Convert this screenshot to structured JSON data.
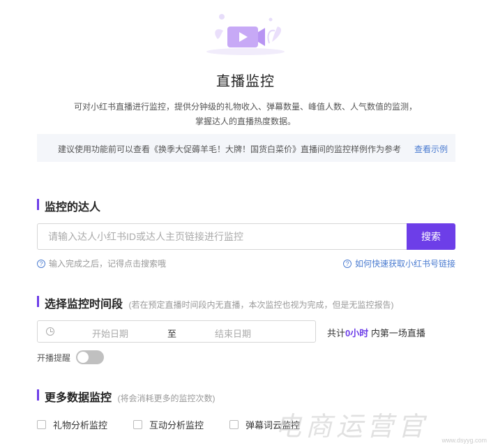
{
  "header": {
    "title": "直播监控",
    "desc_line1": "可对小红书直播进行监控，提供分钟级的礼物收入、弹幕数量、峰值人数、人气数值的监测，",
    "desc_line2": "掌握达人的直播热度数据。"
  },
  "tip": {
    "text": "建议使用功能前可以查看《换季大促薅羊毛！大牌！国货白菜价》直播间的监控样例作为参考",
    "link": "查看示例"
  },
  "monitor_section": {
    "title": "监控的达人",
    "search_placeholder": "请输入达人小红书ID或达人主页链接进行监控",
    "search_button": "搜索",
    "help_left": "输入完成之后，记得点击搜索哦",
    "help_right": "如何快速获取小红书号链接"
  },
  "time_section": {
    "title": "选择监控时间段",
    "note": "(若在预定直播时间段内无直播，本次监控也视为完成，但是无监控报告)",
    "start_placeholder": "开始日期",
    "separator": "至",
    "end_placeholder": "结束日期",
    "total_prefix": "共计",
    "total_value": "0小时",
    "total_suffix": " 内第一场直播",
    "remind_label": "开播提醒"
  },
  "more_section": {
    "title": "更多数据监控",
    "note": "(将会消耗更多的监控次数)",
    "options": [
      "礼物分析监控",
      "互动分析监控",
      "弹幕词云监控"
    ]
  },
  "watermark": {
    "text": "电商运营官",
    "small": "www.dsyyg.com"
  },
  "colors": {
    "accent": "#6d3ee8",
    "link": "#4a7bd0",
    "tip_bg": "#f4f6fa"
  }
}
